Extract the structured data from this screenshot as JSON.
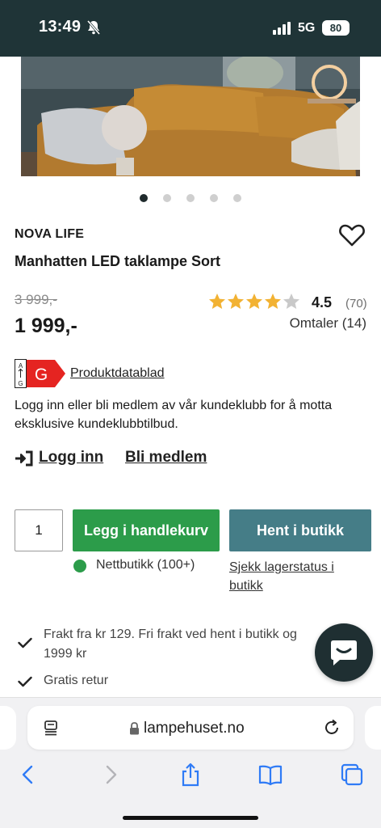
{
  "status_bar": {
    "time": "13:49",
    "network": "5G",
    "battery": "80"
  },
  "carousel": {
    "dots": 5,
    "active_index": 0
  },
  "product": {
    "brand": "NOVA LIFE",
    "title": "Manhatten LED taklampe Sort",
    "old_price": "3 999,-",
    "new_price": "1 999,-",
    "rating": {
      "stars": 4.5,
      "score_label": "4.5",
      "count_label": "(70)"
    },
    "reviews_label": "Omtaler (14)",
    "energy_class": "G",
    "datasheet_label": "Produktdatablad"
  },
  "membership": {
    "text": "Logg inn eller bli medlem av vår kundeklubb for å motta eksklusive kundeklubbtilbud.",
    "login_label": "Logg inn",
    "join_label": "Bli medlem"
  },
  "purchase": {
    "quantity": "1",
    "add_to_cart_label": "Legg i handlekurv",
    "pickup_label": "Hent i butikk",
    "stock_label": "Nettbutikk (100+)",
    "stock_link_label": "Sjekk lagerstatus i butikk"
  },
  "features": [
    "Frakt fra kr 129. Fri frakt ved hent i butikk og 1999 kr",
    "Gratis retur"
  ],
  "browser": {
    "url": "lampehuset.no"
  },
  "colors": {
    "status_bar": "#1f3437",
    "add_to_cart": "#2c9c4a",
    "pickup": "#457d87",
    "star": "#f2b233",
    "energy_g": "#e52421",
    "ios_blue": "#2f7bf6"
  },
  "icons": [
    "bell-slash-icon",
    "signal-icon",
    "heart-icon",
    "star-icon",
    "login-icon",
    "check-icon",
    "chat-icon",
    "reader-icon",
    "lock-icon",
    "reload-icon",
    "back-icon",
    "forward-icon",
    "share-icon",
    "bookmarks-icon",
    "tabs-icon"
  ]
}
